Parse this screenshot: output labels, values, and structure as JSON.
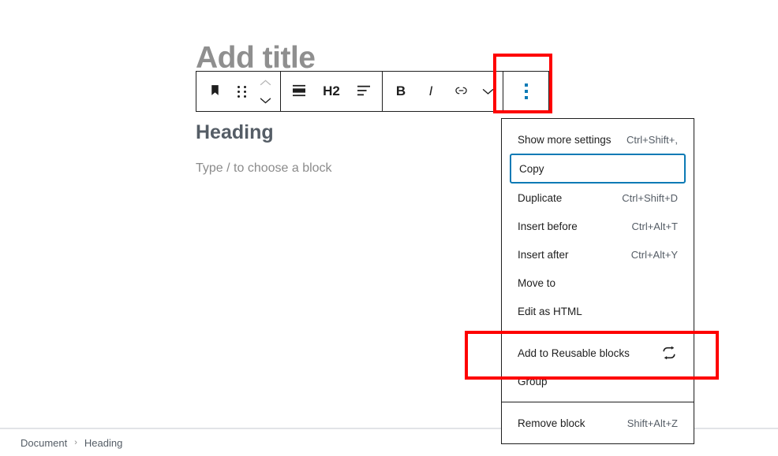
{
  "editor": {
    "title_placeholder": "Add title",
    "heading_block_text": "Heading",
    "paragraph_placeholder": "Type / to choose a block"
  },
  "toolbar": {
    "block_type_icon": "heading-block-icon",
    "drag_handle_icon": "drag-handle-icon",
    "move_up_label": "Move up",
    "move_down_label": "Move down",
    "paragraph_icon": "paragraph-style-icon",
    "heading_level_label": "H2",
    "align_icon": "align-left-icon",
    "bold_label": "B",
    "italic_label": "I",
    "link_icon": "link-icon",
    "more_formats_icon": "chevron-down-icon",
    "options_icon": "kebab-vertical-icon"
  },
  "menu": {
    "groups": [
      {
        "items": [
          {
            "label": "Show more settings",
            "shortcut": "Ctrl+Shift+,",
            "focused": false,
            "icon": ""
          },
          {
            "label": "Copy",
            "shortcut": "",
            "focused": true,
            "icon": ""
          },
          {
            "label": "Duplicate",
            "shortcut": "Ctrl+Shift+D",
            "focused": false,
            "icon": ""
          },
          {
            "label": "Insert before",
            "shortcut": "Ctrl+Alt+T",
            "focused": false,
            "icon": ""
          },
          {
            "label": "Insert after",
            "shortcut": "Ctrl+Alt+Y",
            "focused": false,
            "icon": ""
          },
          {
            "label": "Move to",
            "shortcut": "",
            "focused": false,
            "icon": ""
          },
          {
            "label": "Edit as HTML",
            "shortcut": "",
            "focused": false,
            "icon": ""
          }
        ]
      },
      {
        "items": [
          {
            "label": "Add to Reusable blocks",
            "shortcut": "",
            "focused": false,
            "icon": "reusable-block-icon"
          },
          {
            "label": "Group",
            "shortcut": "",
            "focused": false,
            "icon": ""
          }
        ]
      },
      {
        "items": [
          {
            "label": "Remove block",
            "shortcut": "Shift+Alt+Z",
            "focused": false,
            "icon": ""
          }
        ]
      }
    ]
  },
  "breadcrumb": {
    "items": [
      "Document",
      "Heading"
    ],
    "separator": "›"
  },
  "colors": {
    "accent_blue": "#0b7ab5",
    "annotation_red": "#fe0000",
    "menu_border": "#1e1e1e",
    "placeholder_gray": "#8f8f8f",
    "heading_gray": "#555d66"
  }
}
